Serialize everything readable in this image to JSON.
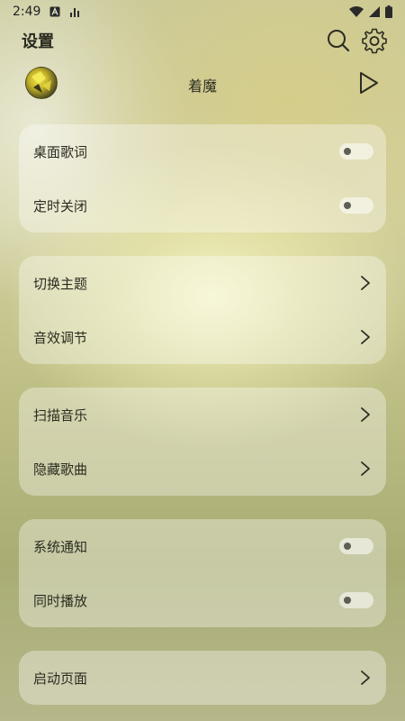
{
  "status_bar": {
    "time": "2:49",
    "icons": [
      "notification-a-icon",
      "signal-bars-icon",
      "wifi-icon",
      "cellular-icon",
      "battery-icon"
    ]
  },
  "header": {
    "title": "设置",
    "search_icon": "search-icon",
    "settings_icon": "gear-icon"
  },
  "now_playing": {
    "song_title": "着魔",
    "play_icon": "play-icon"
  },
  "groups": [
    {
      "rows": [
        {
          "label": "桌面歌词",
          "control": "toggle",
          "on": false
        },
        {
          "label": "定时关闭",
          "control": "toggle",
          "on": false
        }
      ]
    },
    {
      "rows": [
        {
          "label": "切换主题",
          "control": "chevron"
        },
        {
          "label": "音效调节",
          "control": "chevron"
        }
      ]
    },
    {
      "rows": [
        {
          "label": "扫描音乐",
          "control": "chevron"
        },
        {
          "label": "隐藏歌曲",
          "control": "chevron"
        }
      ]
    },
    {
      "rows": [
        {
          "label": "系统通知",
          "control": "toggle",
          "on": false
        },
        {
          "label": "同时播放",
          "control": "toggle",
          "on": false
        }
      ]
    },
    {
      "rows": [
        {
          "label": "启动页面",
          "control": "chevron"
        }
      ]
    }
  ]
}
